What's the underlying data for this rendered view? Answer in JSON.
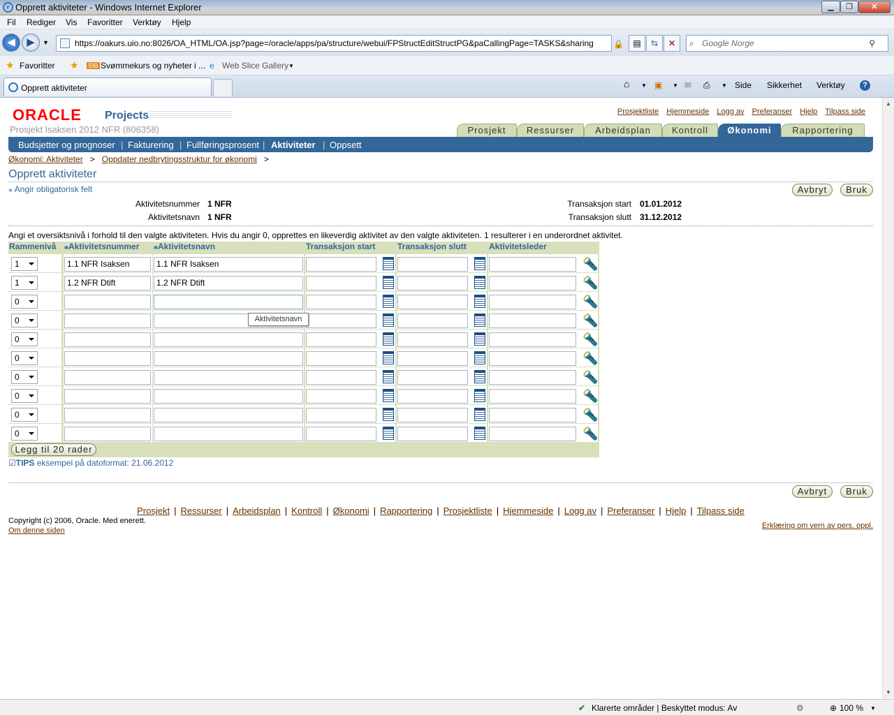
{
  "window": {
    "title": "Opprett aktiviteter - Windows Internet Explorer"
  },
  "menu": [
    "Fil",
    "Rediger",
    "Vis",
    "Favoritter",
    "Verktøy",
    "Hjelp"
  ],
  "address": {
    "url": "https://oakurs.uio.no:8026/OA_HTML/OA.jsp?page=/oracle/apps/pa/structure/webui/FPStructEditStructPG&paCallingPage=TASKS&sharing",
    "search_placeholder": "Google Norge"
  },
  "favorites": {
    "label": "Favoritter",
    "items": [
      "Svømmekurs og nyheter i ...",
      "Web Slice Gallery"
    ]
  },
  "tab": {
    "title": "Opprett aktiviteter"
  },
  "commandbar": {
    "side": "Side",
    "sikkerhet": "Sikkerhet",
    "verktoy": "Verktøy"
  },
  "app": {
    "logo": "ORACLE",
    "product": "Projects",
    "project": "Prosjekt Isaksen 2012 NFR (806358)",
    "global_links": [
      "Prosjektliste",
      "Hjemmeside",
      "Logg av",
      "Preferanser",
      "Hjelp",
      "Tilpass side"
    ],
    "tabs": [
      "Prosjekt",
      "Ressurser",
      "Arbeidsplan",
      "Kontroll",
      "Økonomi",
      "Rapportering"
    ],
    "active_tab": "Økonomi",
    "subtabs": [
      "Budsjetter og prognoser",
      "Fakturering",
      "Fullføringsprosent",
      "Aktiviteter",
      "Oppsett"
    ],
    "active_subtab": "Aktiviteter",
    "breadcrumb": [
      "Økonomi: Aktiviteter",
      "Oppdater nedbrytingsstruktur for økonomi"
    ]
  },
  "page": {
    "title": "Opprett aktiviteter",
    "required_note": "Angir obligatorisk felt",
    "cancel": "Avbryt",
    "apply": "Bruk",
    "info": {
      "aktivitetsnummer_label": "Aktivitetsnummer",
      "aktivitetsnummer": "1 NFR",
      "aktivitetsnavn_label": "Aktivitetsnavn",
      "aktivitetsnavn": "1 NFR",
      "start_label": "Transaksjon start",
      "start": "01.01.2012",
      "slutt_label": "Transaksjon slutt",
      "slutt": "31.12.2012"
    },
    "instructions": "Angi et oversiktsnivå i forhold til den valgte aktiviteten. Hvis du angir 0, opprettes en likeverdig aktivitet av den valgte aktiviteten. 1 resulterer i en underordnet aktivitet.",
    "columns": [
      "Rammenivå",
      "Aktivitetsnummer",
      "Aktivitetsnavn",
      "Transaksjon start",
      "Transaksjon slutt",
      "Aktivitetsleder"
    ],
    "rows": [
      {
        "level": "1",
        "number": "1.1 NFR Isaksen",
        "name": "1.1 NFR Isaksen",
        "start": "",
        "end": "",
        "manager": ""
      },
      {
        "level": "1",
        "number": "1.2 NFR Dtift",
        "name": "1.2 NFR Dtift",
        "start": "",
        "end": "",
        "manager": ""
      },
      {
        "level": "0",
        "number": "",
        "name": "",
        "start": "",
        "end": "",
        "manager": ""
      },
      {
        "level": "0",
        "number": "",
        "name": "",
        "start": "",
        "end": "",
        "manager": ""
      },
      {
        "level": "0",
        "number": "",
        "name": "",
        "start": "",
        "end": "",
        "manager": ""
      },
      {
        "level": "0",
        "number": "",
        "name": "",
        "start": "",
        "end": "",
        "manager": ""
      },
      {
        "level": "0",
        "number": "",
        "name": "",
        "start": "",
        "end": "",
        "manager": ""
      },
      {
        "level": "0",
        "number": "",
        "name": "",
        "start": "",
        "end": "",
        "manager": ""
      },
      {
        "level": "0",
        "number": "",
        "name": "",
        "start": "",
        "end": "",
        "manager": ""
      },
      {
        "level": "0",
        "number": "",
        "name": "",
        "start": "",
        "end": "",
        "manager": ""
      }
    ],
    "add_rows": "Legg til 20 rader",
    "tooltip": "Aktivitetsnavn",
    "tips_label": "TIPS",
    "tips": "eksempel på datoformat: 21.06.2012"
  },
  "footer": {
    "links": [
      "Prosjekt",
      "Ressurser",
      "Arbeidsplan",
      "Kontroll",
      "Økonomi",
      "Rapportering",
      "Prosjektliste",
      "Hjemmeside",
      "Logg av",
      "Preferanser",
      "Hjelp",
      "Tilpass side"
    ],
    "copyright": "Copyright (c) 2006, Oracle. Med enerett.",
    "about": "Om denne siden",
    "privacy": "Erklæring om vern av pers. oppl."
  },
  "status": {
    "zone": "Klarerte områder | Beskyttet modus: Av",
    "zoom": "100 %"
  }
}
